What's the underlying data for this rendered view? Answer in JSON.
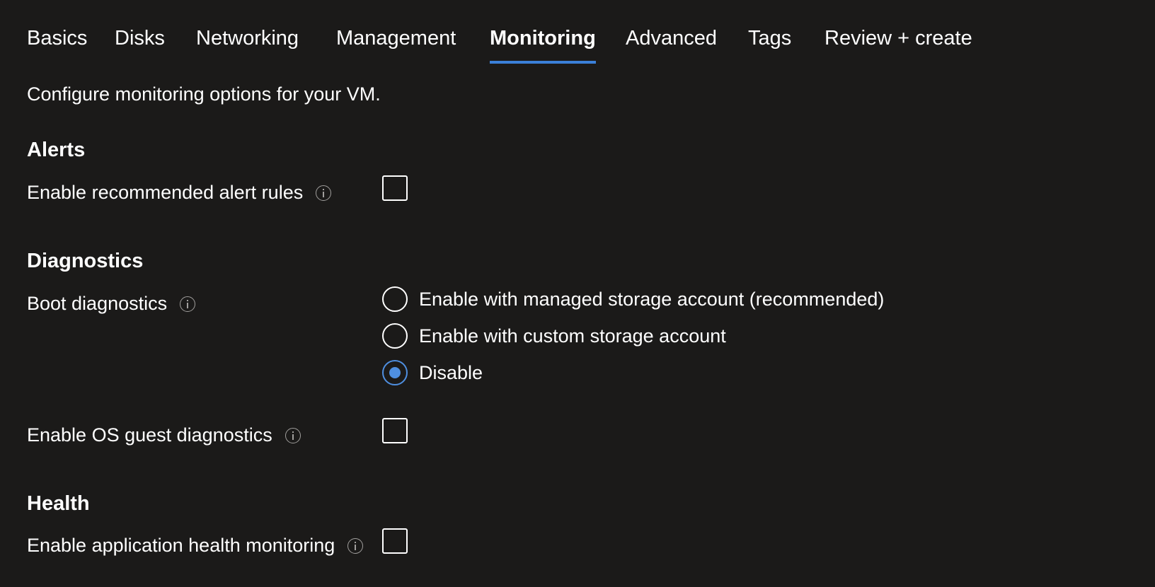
{
  "tabs": [
    {
      "label": "Basics",
      "active": false
    },
    {
      "label": "Disks",
      "active": false
    },
    {
      "label": "Networking",
      "active": false
    },
    {
      "label": "Management",
      "active": false
    },
    {
      "label": "Monitoring",
      "active": true
    },
    {
      "label": "Advanced",
      "active": false
    },
    {
      "label": "Tags",
      "active": false
    },
    {
      "label": "Review + create",
      "active": false
    }
  ],
  "intro": "Configure monitoring options for your VM.",
  "alerts": {
    "title": "Alerts",
    "recommended_rules": {
      "label": "Enable recommended alert rules",
      "checked": false
    }
  },
  "diagnostics": {
    "title": "Diagnostics",
    "boot": {
      "label": "Boot diagnostics",
      "options": [
        {
          "label": "Enable with managed storage account (recommended)",
          "selected": false
        },
        {
          "label": "Enable with custom storage account",
          "selected": false
        },
        {
          "label": "Disable",
          "selected": true
        }
      ]
    },
    "os_guest": {
      "label": "Enable OS guest diagnostics",
      "checked": false
    }
  },
  "health": {
    "title": "Health",
    "app_health": {
      "label": "Enable application health monitoring",
      "checked": false
    }
  },
  "colors": {
    "background": "#1b1a19",
    "accent": "#3b80d9",
    "radio_selected": "#4f8fe0"
  }
}
